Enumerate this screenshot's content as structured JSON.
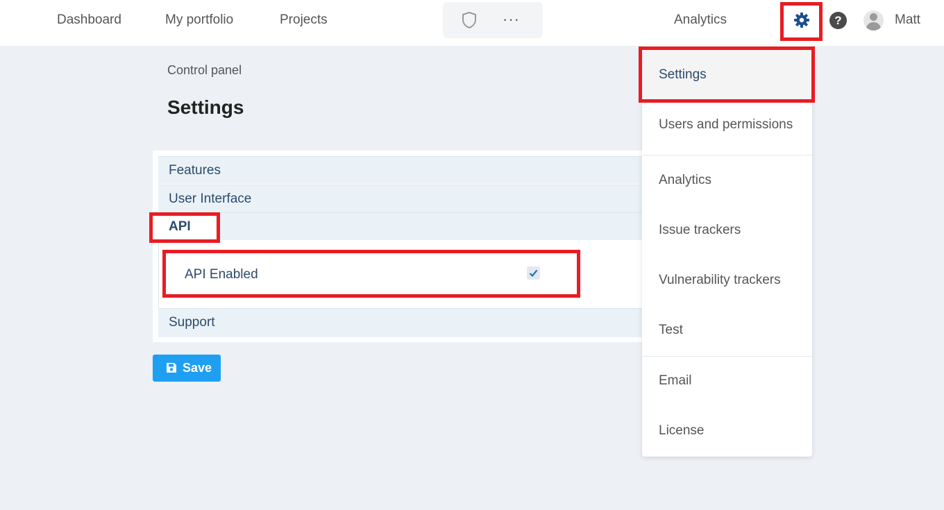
{
  "nav": {
    "dashboard": "Dashboard",
    "portfolio": "My portfolio",
    "projects": "Projects",
    "more": "···",
    "analytics": "Analytics",
    "help": "?",
    "user": "Matt"
  },
  "icons": {
    "shield": "shield-icon",
    "gear": "gear-icon",
    "help": "help-icon",
    "avatar": "user-avatar",
    "save": "floppy-disk-icon",
    "check": "checkmark-icon"
  },
  "page": {
    "breadcrumb": "Control panel",
    "title": "Settings"
  },
  "sections": {
    "features": "Features",
    "ui": "User Interface",
    "api": "API",
    "support": "Support"
  },
  "api": {
    "enabled_label": "API Enabled",
    "enabled": true
  },
  "save_label": "Save",
  "menu": {
    "settings": "Settings",
    "users": "Users and permissions",
    "analytics": "Analytics",
    "issue_trackers": "Issue trackers",
    "vuln_trackers": "Vulnerability trackers",
    "test": "Test",
    "email": "Email",
    "license": "License"
  },
  "colors": {
    "highlight": "#e81c24",
    "primary": "#1e9ff2",
    "gear": "#1b4f8a",
    "section_bg": "#eaf2f8",
    "page_bg": "#edf1f5"
  }
}
